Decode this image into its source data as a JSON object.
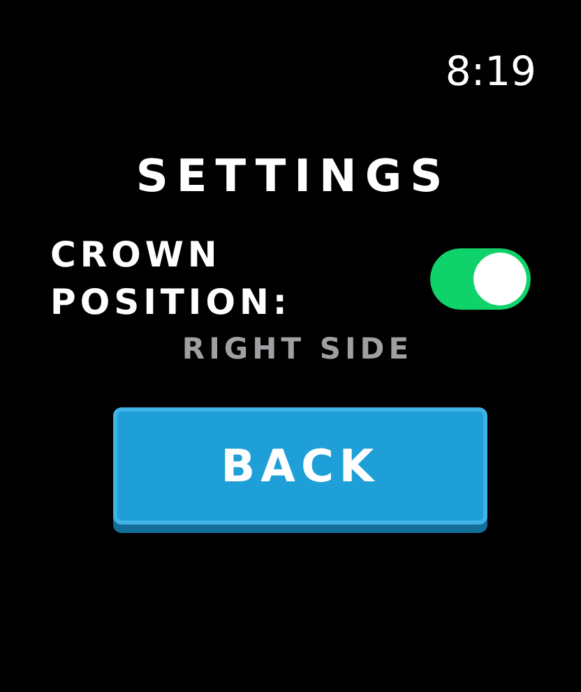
{
  "status_bar": {
    "time": "8:19"
  },
  "title": "SETTINGS",
  "setting": {
    "label": "CROWN POSITION:",
    "on": true,
    "value": "RIGHT SIDE"
  },
  "button": {
    "label": "BACK"
  }
}
